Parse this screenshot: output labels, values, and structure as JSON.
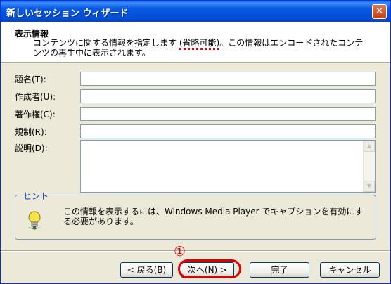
{
  "window": {
    "title": "新しいセッション ウィザード",
    "close_label": "✕"
  },
  "header": {
    "title": "表示情報",
    "desc_pre": "コンテンツに関する情報を指定します ",
    "desc_optional": "(省略可能)",
    "desc_post": "。この情報はエンコードされたコンテンツの再生中に表示されます。"
  },
  "fields": [
    {
      "label": "題名(T):",
      "value": ""
    },
    {
      "label": "作成者(U):",
      "value": ""
    },
    {
      "label": "著作権(C):",
      "value": ""
    },
    {
      "label": "規制(R):",
      "value": ""
    },
    {
      "label": "説明(D):",
      "value": ""
    }
  ],
  "hint": {
    "legend": "ヒント",
    "text": "この情報を表示するには、Windows Media Player でキャプションを有効にする必要があります。",
    "icon": "lightbulb-icon"
  },
  "annotation": {
    "number": "①",
    "color": "#e00000"
  },
  "buttons": {
    "back": "< 戻る(B)",
    "next": "次へ(N) >",
    "finish": "完了",
    "cancel": "キャンセル"
  },
  "colors": {
    "titlebar": "#0a5be2",
    "dialog_bg": "#ece9d8",
    "input_border": "#7f9db9"
  }
}
